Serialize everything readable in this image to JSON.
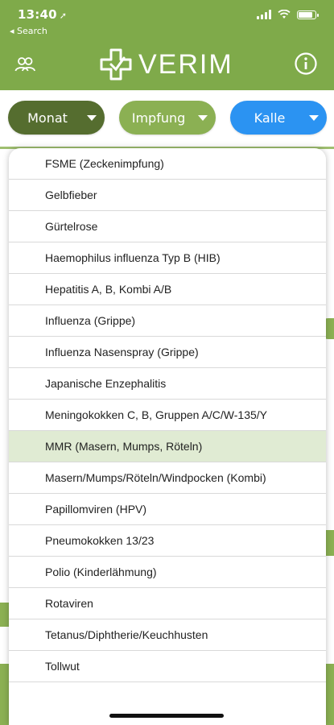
{
  "status": {
    "time": "13:40",
    "back_label": "◂ Search"
  },
  "app": {
    "brand": "VERIM"
  },
  "filters": {
    "month": "Monat",
    "vaccination": "Impfung",
    "person": "Kalle"
  },
  "colors": {
    "header_green": "#7faa4a",
    "month_pill": "#556d2f",
    "vaccination_pill": "#8bb053",
    "person_pill": "#2b93f2",
    "selected_row": "#e0ebd3"
  },
  "dropdown": {
    "selected_index": 9,
    "items": [
      "FSME (Zeckenimpfung)",
      "Gelbfieber",
      "Gürtelrose",
      "Haemophilus influenza Typ B (HIB)",
      "Hepatitis A, B, Kombi A/B",
      "Influenza (Grippe)",
      "Influenza Nasenspray (Grippe)",
      "Japanische Enzephalitis",
      "Meningokokken C, B, Gruppen A/C/W-135/Y",
      "MMR (Masern, Mumps, Röteln)",
      "Masern/Mumps/Röteln/Windpocken (Kombi)",
      "Papillomviren (HPV)",
      "Pneumokokken 13/23",
      "Polio (Kinderlähmung)",
      "Rotaviren",
      "Tetanus/Diphtherie/Keuchhusten",
      "Tollwut"
    ]
  },
  "icons": {
    "users": "users-icon",
    "logo": "medical-cross-icon",
    "info": "info-icon",
    "location": "location-arrow-icon",
    "signal": "signal-icon",
    "wifi": "wifi-icon",
    "battery": "battery-icon"
  }
}
